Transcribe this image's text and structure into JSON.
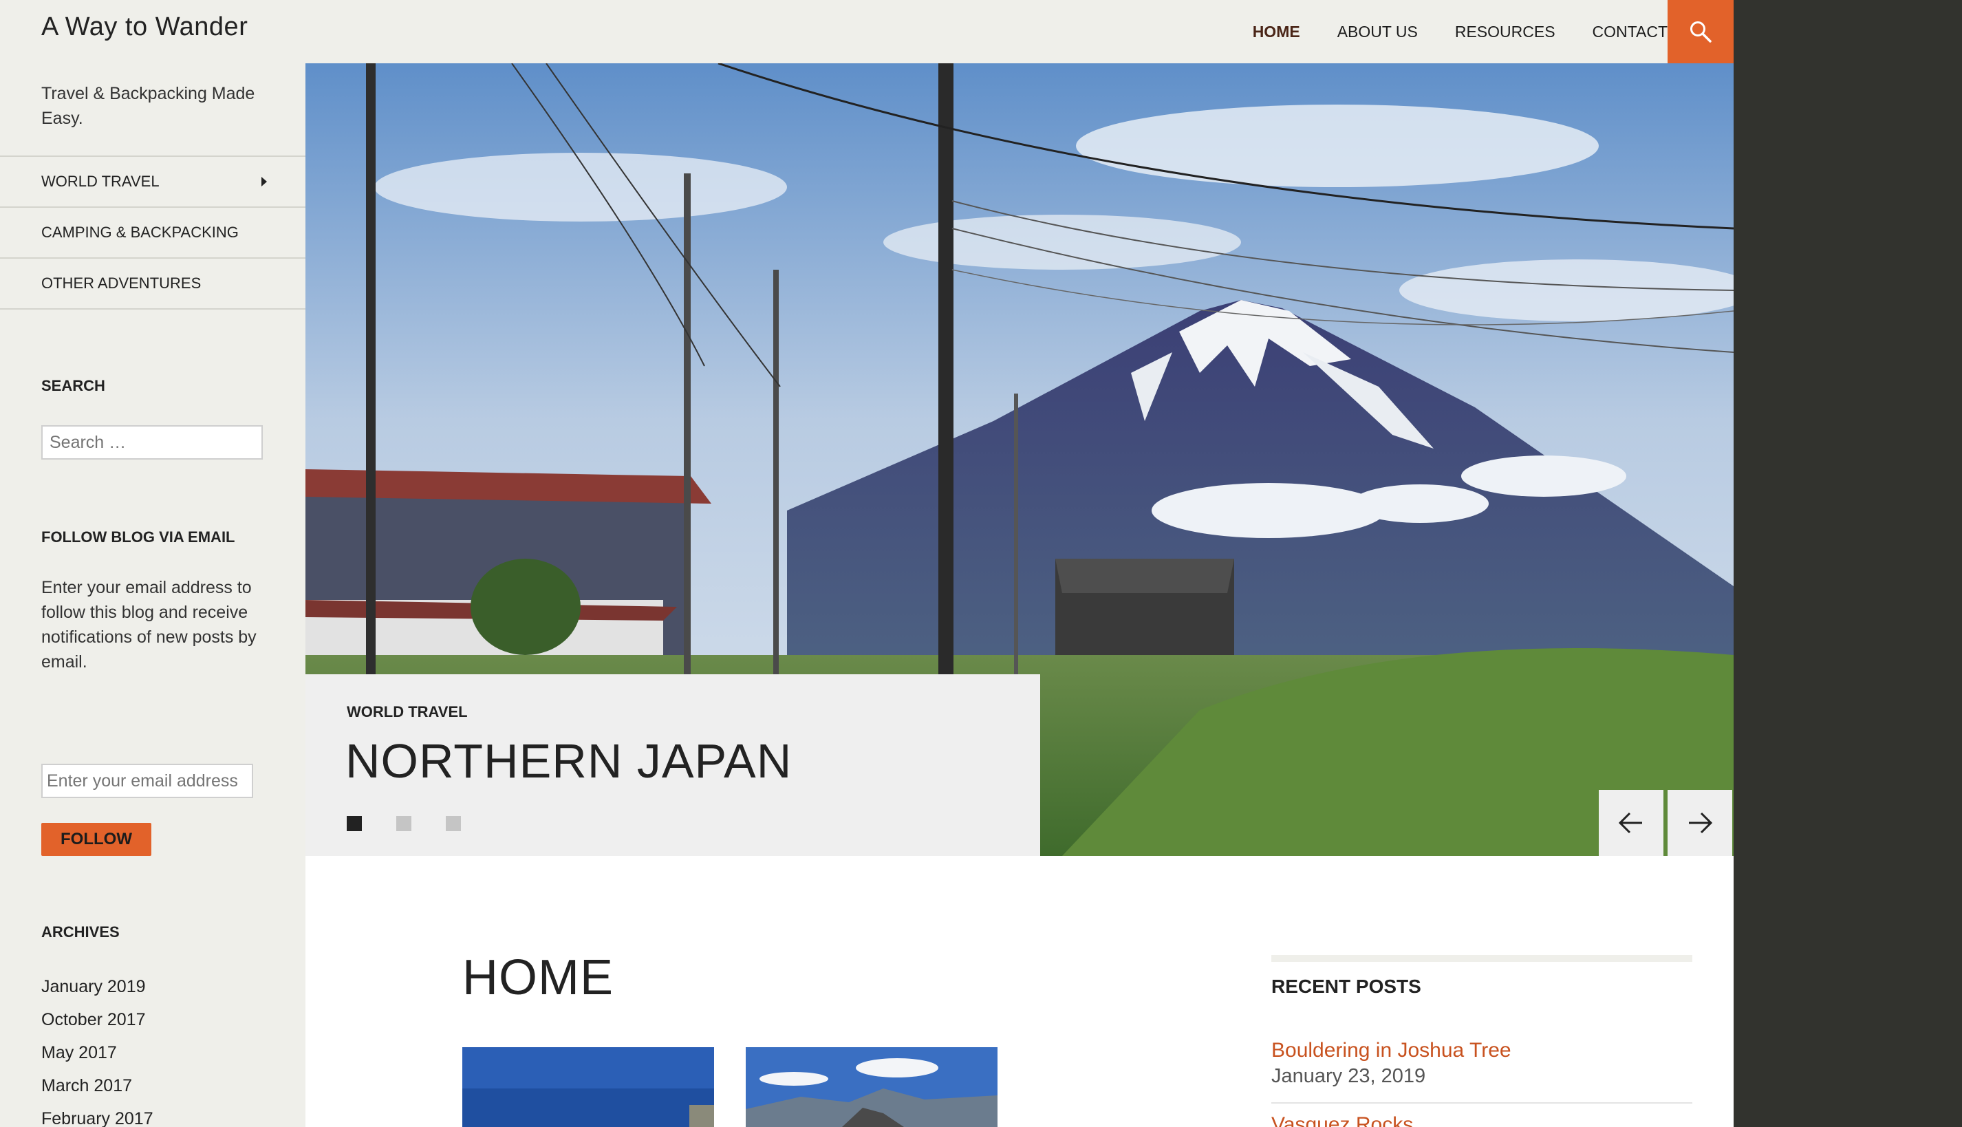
{
  "site": {
    "title": "A Way to Wander",
    "tagline": "Travel & Backpacking Made Easy."
  },
  "nav": {
    "items": [
      {
        "label": "HOME",
        "active": true
      },
      {
        "label": "ABOUT US"
      },
      {
        "label": "RESOURCES"
      },
      {
        "label": "CONTACT"
      }
    ],
    "search_icon": "search-icon"
  },
  "sidebar": {
    "menu": [
      {
        "label": "WORLD TRAVEL",
        "has_submenu": true
      },
      {
        "label": "CAMPING & BACKPACKING"
      },
      {
        "label": "OTHER ADVENTURES"
      }
    ],
    "search": {
      "title": "SEARCH",
      "placeholder": "Search …"
    },
    "follow": {
      "title": "FOLLOW BLOG VIA EMAIL",
      "description": "Enter your email address to follow this blog and receive notifications of new posts by email.",
      "email_placeholder": "Enter your email address",
      "button_label": "FOLLOW"
    },
    "archives": {
      "title": "ARCHIVES",
      "items": [
        "January 2019",
        "October 2017",
        "May 2017",
        "March 2017",
        "February 2017"
      ]
    }
  },
  "slider": {
    "category": "WORLD TRAVEL",
    "title": "NORTHERN JAPAN",
    "current_slide": 1,
    "total_slides": 3,
    "prev_icon": "arrow-left-icon",
    "next_icon": "arrow-right-icon"
  },
  "main": {
    "page_title": "HOME"
  },
  "recent_posts": {
    "title": "RECENT POSTS",
    "items": [
      {
        "title": "Bouldering in Joshua Tree",
        "date": "January 23, 2019"
      },
      {
        "title": "Vasquez Rocks"
      }
    ]
  },
  "colors": {
    "accent": "#e2622a",
    "link": "#c8521f",
    "header_bg": "#efefea",
    "dark_bg": "#32332e"
  }
}
